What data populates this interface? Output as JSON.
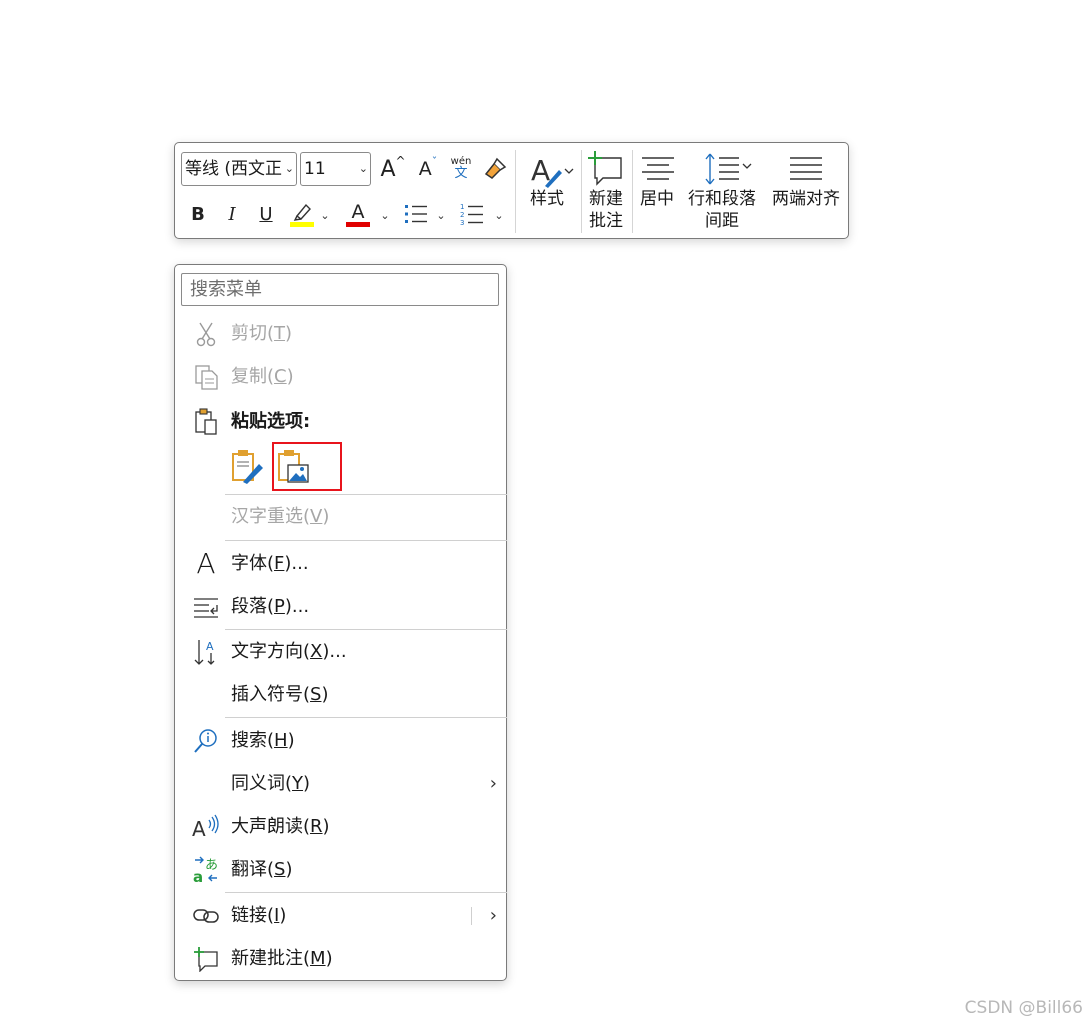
{
  "mini_toolbar": {
    "font_name": "等线 (西文正",
    "font_size": "11",
    "grow_font_label": "A",
    "shrink_font_label": "A",
    "phonetic_top": "wén",
    "phonetic_bottom": "文",
    "bold_label": "B",
    "italic_label": "I",
    "underline_label": "U",
    "font_color_label": "A",
    "highlight_color": "#ffff00",
    "font_color": "#e00000",
    "styles_label": "样式",
    "new_comment_label_line1": "新建",
    "new_comment_label_line2": "批注",
    "center_label": "居中",
    "spacing_label_line1": "行和段落",
    "spacing_label_line2": "间距",
    "justify_label": "两端对齐"
  },
  "context_menu": {
    "search_placeholder": "搜索菜单",
    "items": {
      "cut": {
        "label": "剪切(",
        "key": "T",
        "suffix": ")"
      },
      "copy": {
        "label": "复制(",
        "key": "C",
        "suffix": ")"
      },
      "paste_options": {
        "label": "粘贴选项:"
      },
      "reconvert": {
        "label": "汉字重选(",
        "key": "V",
        "suffix": ")"
      },
      "font": {
        "label": "字体(",
        "key": "F",
        "suffix": ")..."
      },
      "paragraph": {
        "label": "段落(",
        "key": "P",
        "suffix": ")..."
      },
      "text_direction": {
        "label": "文字方向(",
        "key": "X",
        "suffix": ")..."
      },
      "insert_symbol": {
        "label": "插入符号(",
        "key": "S",
        "suffix": ")"
      },
      "search": {
        "label": "搜索(",
        "key": "H",
        "suffix": ")"
      },
      "synonyms": {
        "label": "同义词(",
        "key": "Y",
        "suffix": ")"
      },
      "read_aloud": {
        "label": "大声朗读(",
        "key": "R",
        "suffix": ")"
      },
      "translate": {
        "label": "翻译(",
        "key": "S",
        "suffix": ")"
      },
      "link": {
        "label": "链接(",
        "key": "I",
        "suffix": ")"
      },
      "new_comment": {
        "label": "新建批注(",
        "key": "M",
        "suffix": ")"
      }
    },
    "submenu_arrow": "›",
    "highlight_color": "#e8141c"
  },
  "watermark": "CSDN @Bill66"
}
